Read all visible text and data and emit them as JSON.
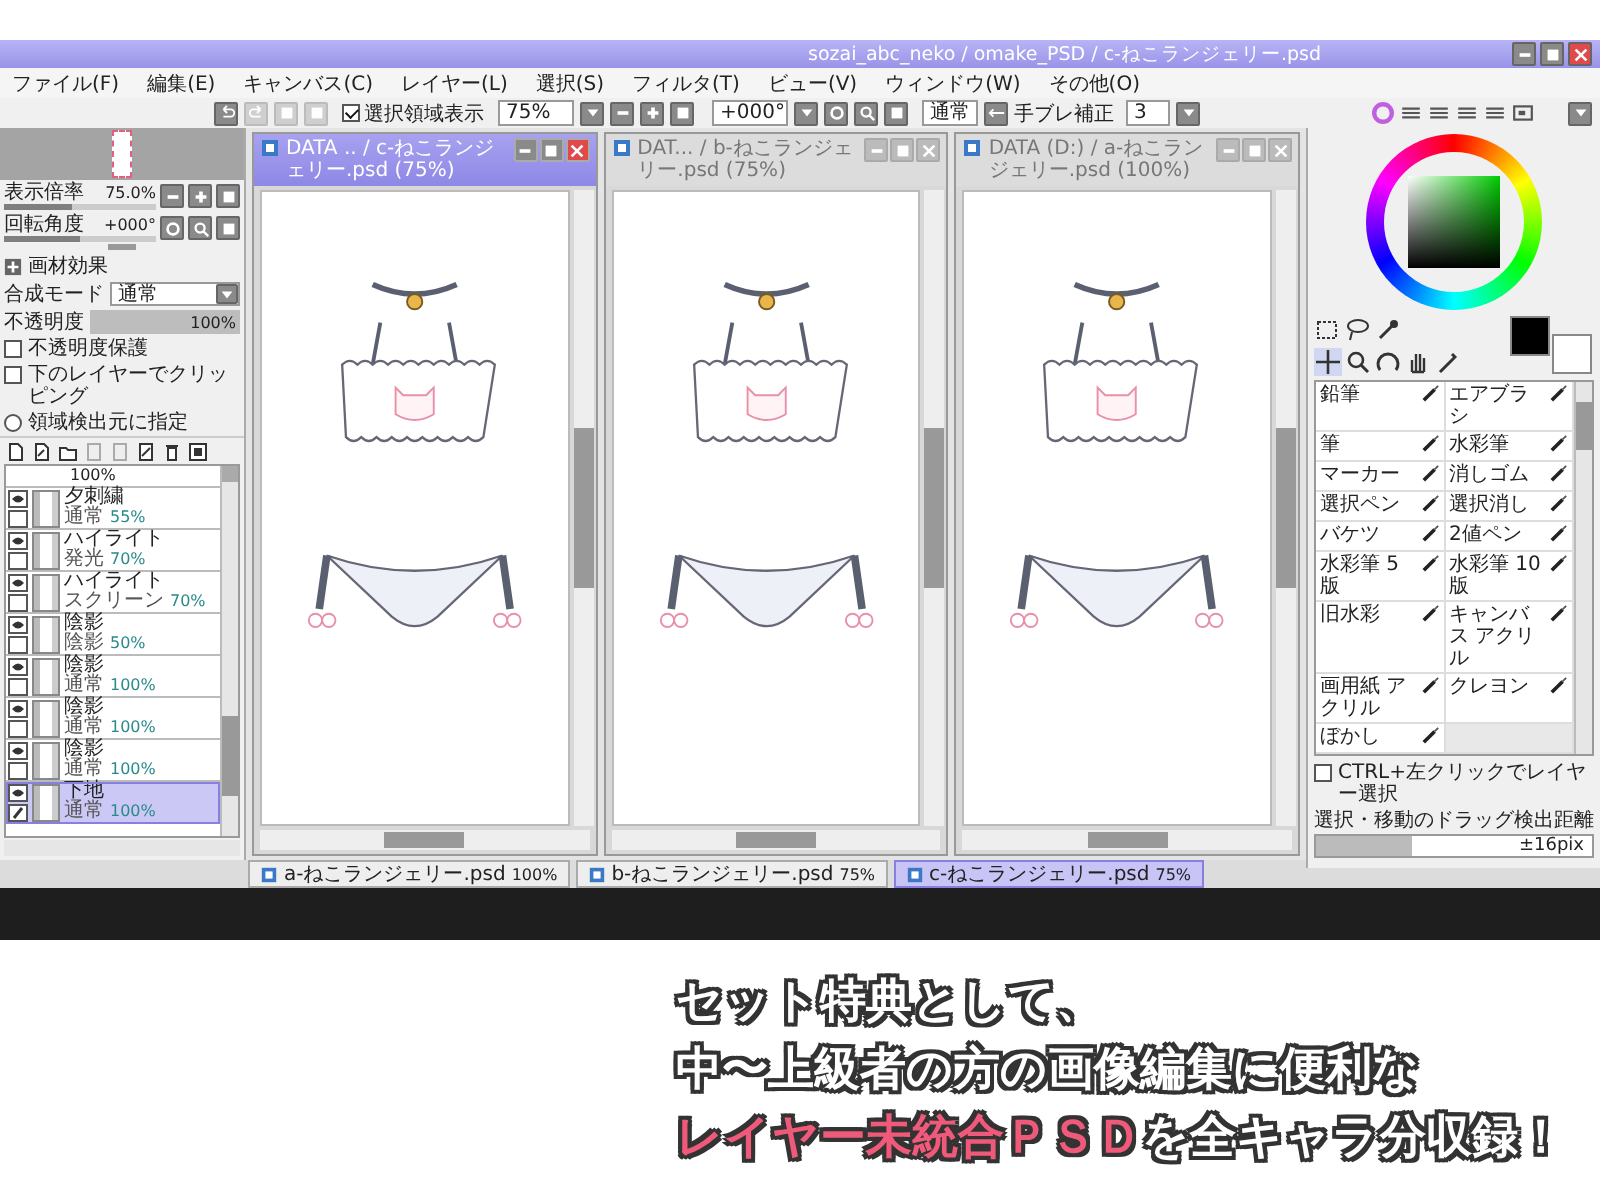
{
  "window": {
    "title": "sozai_abc_neko / omake_PSD / c-ねこランジェリー.psd"
  },
  "menu": [
    "ファイル(F)",
    "編集(E)",
    "キャンバス(C)",
    "レイヤー(L)",
    "選択(S)",
    "フィルタ(T)",
    "ビュー(V)",
    "ウィンドウ(W)",
    "その他(O)"
  ],
  "toolbar": {
    "show_selection": {
      "label": "選択領域表示",
      "checked": true
    },
    "zoom": "75%",
    "rotation": "+000°",
    "blend": "通常",
    "stabilizer_label": "手ブレ補正",
    "stabilizer": "3"
  },
  "navigator": {
    "zoom": {
      "label": "表示倍率",
      "value": "75.0%",
      "level": 0.45
    },
    "rotation": {
      "label": "回転角度",
      "value": "+000°",
      "level": 0.5
    }
  },
  "layer_panel": {
    "texture_label": "画材効果",
    "blend": {
      "label": "合成モード",
      "value": "通常"
    },
    "opacity": {
      "label": "不透明度",
      "value": "100%",
      "level": 1
    },
    "options": [
      {
        "kind": "checkbox",
        "label": "不透明度保護",
        "checked": false
      },
      {
        "kind": "checkbox",
        "label": "下のレイヤーでクリッピング",
        "checked": false
      },
      {
        "kind": "radio",
        "label": "領域検出元に指定",
        "checked": false
      }
    ]
  },
  "layers": [
    {
      "kind": "cut",
      "opacity": "100%"
    },
    {
      "kind": "full",
      "name": "夕刺繍",
      "mode": "通常",
      "opacity": "55%",
      "visible": true,
      "selected": false
    },
    {
      "kind": "full",
      "name": "ハイライト",
      "mode": "発光",
      "opacity": "70%",
      "visible": true,
      "selected": false
    },
    {
      "kind": "full",
      "name": "ハイライト",
      "mode": "スクリーン",
      "opacity": "70%",
      "visible": true,
      "selected": false
    },
    {
      "kind": "full",
      "name": "陰影",
      "mode": "陰影",
      "opacity": "50%",
      "visible": true,
      "selected": false
    },
    {
      "kind": "full",
      "name": "陰影",
      "mode": "通常",
      "opacity": "100%",
      "visible": true,
      "selected": false
    },
    {
      "kind": "full",
      "name": "陰影",
      "mode": "通常",
      "opacity": "100%",
      "visible": true,
      "selected": false
    },
    {
      "kind": "full",
      "name": "陰影",
      "mode": "通常",
      "opacity": "100%",
      "visible": true,
      "selected": false
    },
    {
      "kind": "full",
      "name": "下地",
      "mode": "通常",
      "opacity": "100%",
      "visible": true,
      "selected": true
    }
  ],
  "documents": [
    {
      "title": "DATA .. / c-ねこランジェリー.psd (75%)",
      "selected": true
    },
    {
      "title": "DAT... / b-ねこランジェリー.psd (75%)",
      "selected": false
    },
    {
      "title": "DATA (D:) / a-ねこランジェリー.psd (100%)",
      "selected": false
    }
  ],
  "doc_tabs": [
    {
      "label": "a-ねこランジェリー.psd",
      "zoom": "100%",
      "selected": false
    },
    {
      "label": "b-ねこランジェリー.psd",
      "zoom": "75%",
      "selected": false
    },
    {
      "label": "c-ねこランジェリー.psd",
      "zoom": "75%",
      "selected": true
    }
  ],
  "tools": [
    "鉛筆",
    "エアブラシ",
    "筆",
    "水彩筆",
    "マーカー",
    "消しゴム",
    "選択ペン",
    "選択消し",
    "バケツ",
    "2値ペン",
    "水彩筆 5版",
    "水彩筆 10版",
    "旧水彩",
    "キャンバス アクリル",
    "画用紙 アクリル",
    "クレヨン",
    "ぼかし"
  ],
  "right_panel": {
    "ctrl_option": {
      "label": "CTRL+左クリックでレイヤー選択",
      "checked": false
    },
    "drag_label": "選択・移動のドラッグ検出距離",
    "drag": {
      "value": "±16pix",
      "level": 0.35
    }
  },
  "promo": {
    "lines": [
      [
        {
          "text": "セット特典として、",
          "emphasis": false
        }
      ],
      [
        {
          "text": "中〜上級者の方の画像編集に便利な",
          "emphasis": false
        }
      ],
      [
        {
          "text": "レイヤー未統合ＰＳＤ",
          "emphasis": true
        },
        {
          "text": "を全キャラ分収録！",
          "emphasis": false
        }
      ]
    ]
  }
}
